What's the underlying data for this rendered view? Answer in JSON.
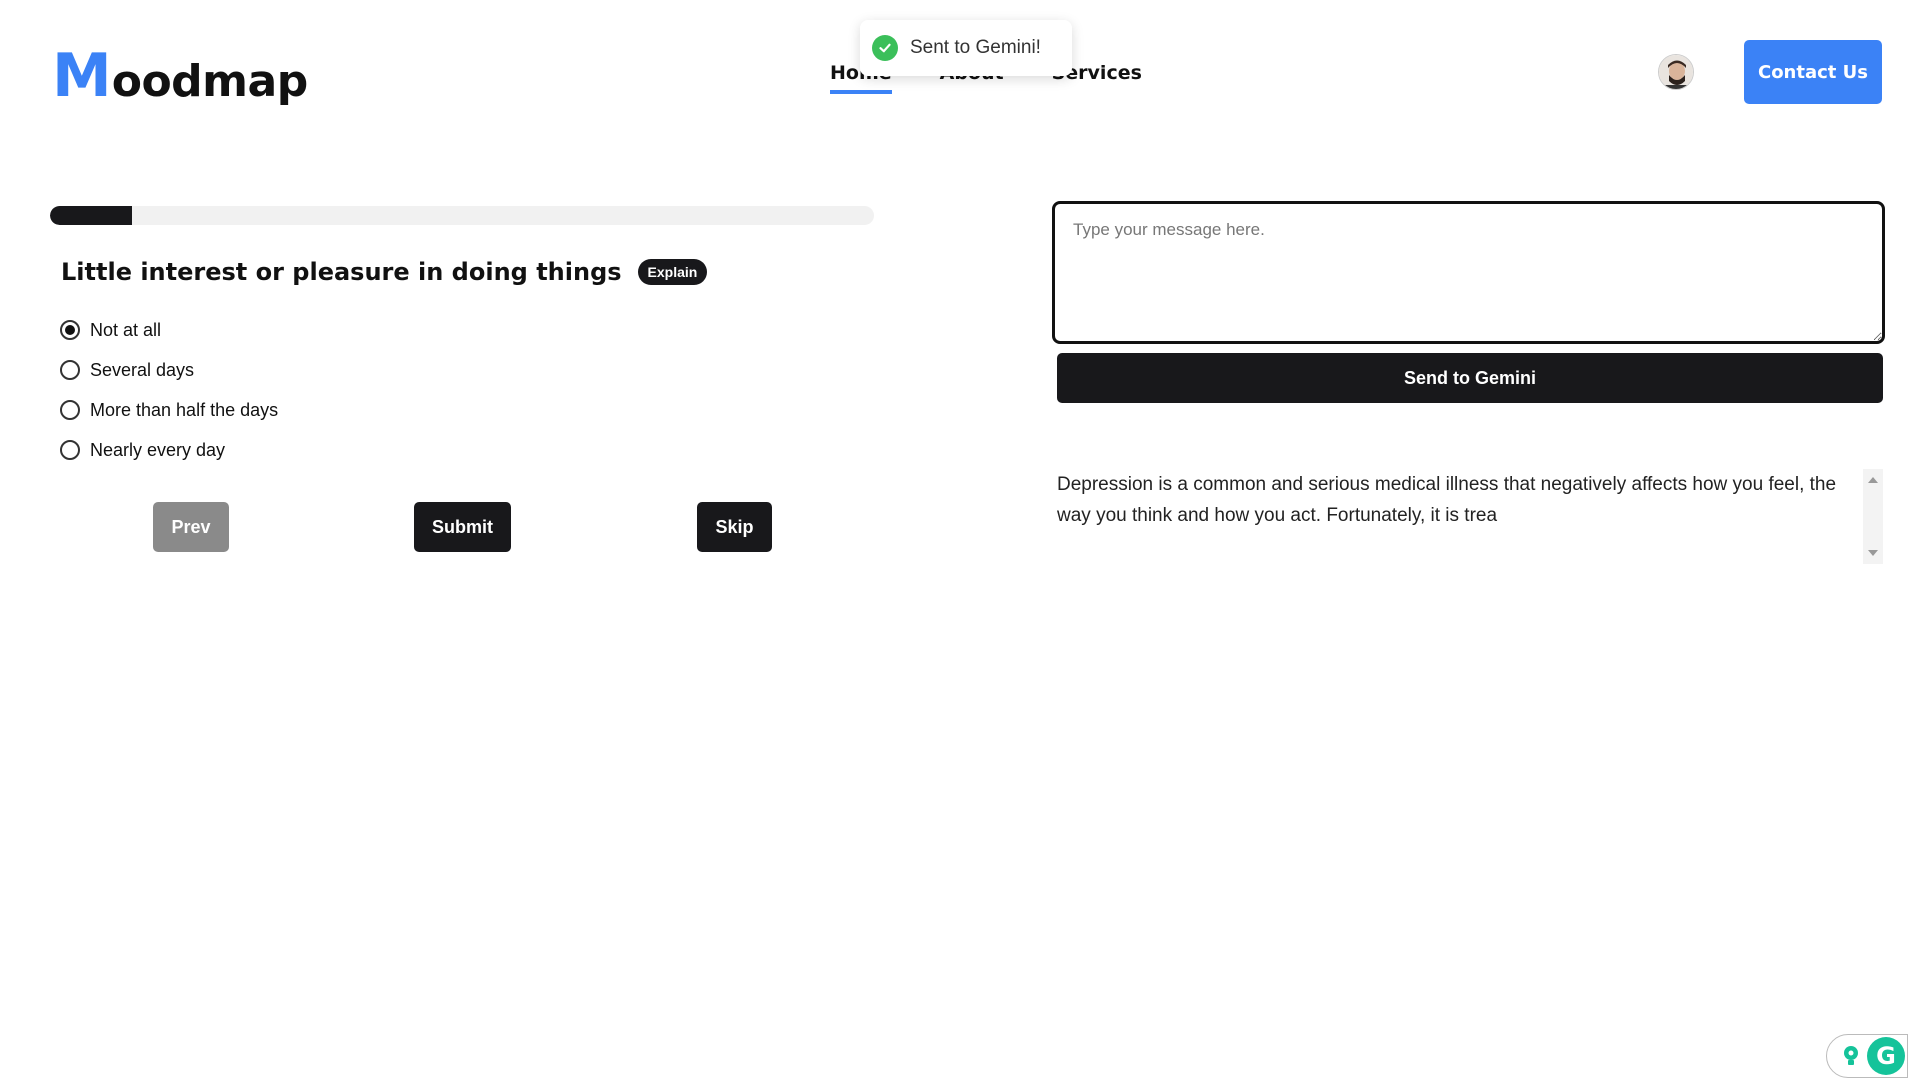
{
  "brand": {
    "logo_first": "M",
    "logo_rest": "oodmap",
    "accent": "#3b82f6"
  },
  "nav": {
    "items": [
      {
        "label": "Home",
        "active": true
      },
      {
        "label": "About"
      },
      {
        "label": "Services"
      }
    ]
  },
  "toast": {
    "message": "Sent to Gemini!",
    "icon": "check-circle-icon",
    "color": "#3bbf5a"
  },
  "header": {
    "avatar_icon": "user-avatar",
    "contact_label": "Contact Us"
  },
  "quiz": {
    "progress": 0.1,
    "question": "Little interest or pleasure in doing things",
    "explain_label": "Explain",
    "options": [
      {
        "label": "Not at all",
        "selected": true
      },
      {
        "label": "Several days",
        "selected": false
      },
      {
        "label": "More than half the days",
        "selected": false
      },
      {
        "label": "Nearly every day",
        "selected": false
      }
    ],
    "prev_label": "Prev",
    "submit_label": "Submit",
    "skip_label": "Skip"
  },
  "chat": {
    "placeholder": "Type your message here.",
    "send_label": "Send to Gemini",
    "response": "Depression is a common and serious medical illness that negatively affects how you feel, the way you think and how you act. Fortunately, it is trea"
  },
  "widget": {
    "icon": "grammarly-icon",
    "letter": "G"
  }
}
